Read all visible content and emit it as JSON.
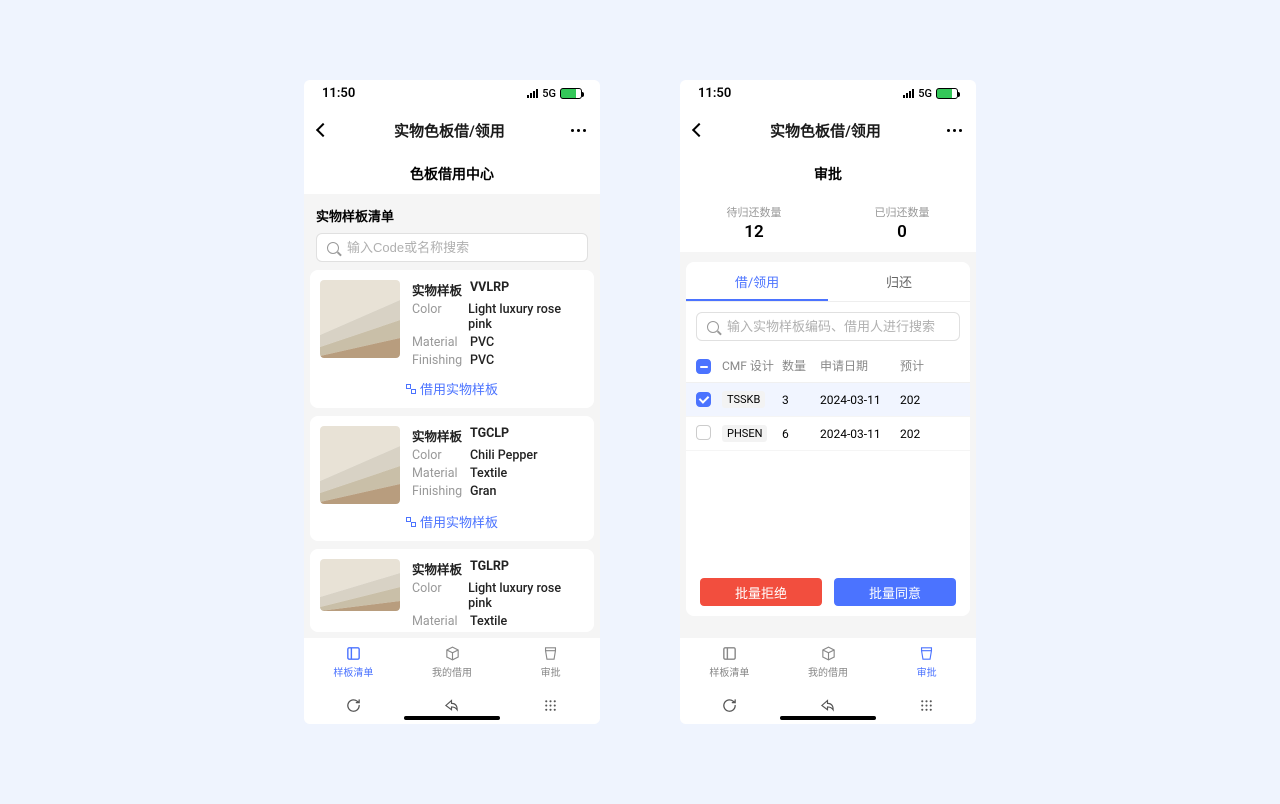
{
  "status": {
    "time": "11:50",
    "network": "5G"
  },
  "nav": {
    "title": "实物色板借/领用"
  },
  "left": {
    "subtitle": "色板借用中心",
    "section_title": "实物样板清单",
    "search": {
      "placeholder": "输入Code或名称搜索"
    },
    "label_sample": "实物样板",
    "label_color": "Color",
    "label_material": "Material",
    "label_finishing": "Finishing",
    "action_label": "借用实物样板",
    "items": [
      {
        "code": "VVLRP",
        "color": "Light luxury rose pink",
        "material": "PVC",
        "finishing": "PVC"
      },
      {
        "code": "TGCLP",
        "color": "Chili Pepper",
        "material": "Textile",
        "finishing": "Gran"
      },
      {
        "code": "TGLRP",
        "color": "Light luxury rose pink",
        "material": "Textile",
        "finishing": ""
      }
    ]
  },
  "right": {
    "subtitle": "审批",
    "stats": {
      "pending_label": "待归还数量",
      "pending_value": "12",
      "returned_label": "已归还数量",
      "returned_value": "0"
    },
    "tabs": {
      "borrow": "借/领用",
      "return": "归还"
    },
    "search": {
      "placeholder": "输入实物样板编码、借用人进行搜索"
    },
    "columns": {
      "design": "CMF 设计",
      "qty": "数量",
      "date": "申请日期",
      "expect": "预计"
    },
    "rows": [
      {
        "design": "TSSKB",
        "qty": "3",
        "date": "2024-03-11",
        "expect": "202",
        "checked": true
      },
      {
        "design": "PHSEN",
        "qty": "6",
        "date": "2024-03-11",
        "expect": "202",
        "checked": false
      }
    ],
    "buttons": {
      "reject": "批量拒绝",
      "approve": "批量同意"
    }
  },
  "tabbar": {
    "list": "样板清单",
    "mine": "我的借用",
    "approval": "审批"
  }
}
